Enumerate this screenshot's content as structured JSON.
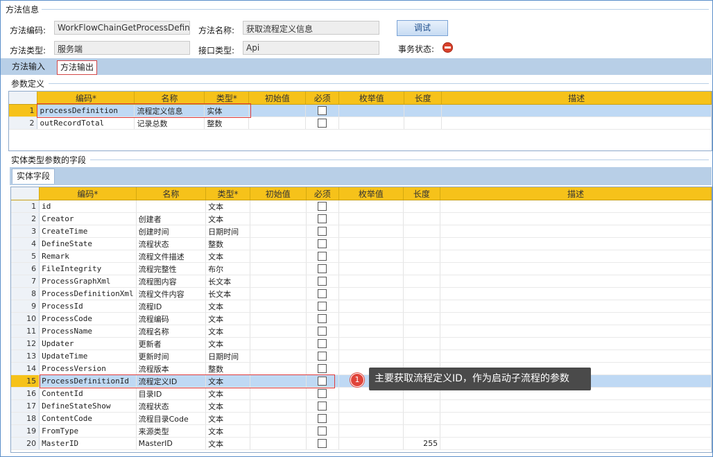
{
  "method_info": {
    "title": "方法信息",
    "code_label": "方法编码:",
    "code_value": "WorkFlowChainGetProcessDefinition",
    "name_label": "方法名称:",
    "name_value": "获取流程定义信息",
    "type_label": "方法类型:",
    "type_value": "服务端",
    "interface_label": "接口类型:",
    "interface_value": "Api",
    "debug_button": "调试",
    "tx_status_label": "事务状态:",
    "tx_status_icon": "no-entry-icon"
  },
  "tabs": [
    {
      "label": "方法输入",
      "active": false
    },
    {
      "label": "方法输出",
      "active": true
    }
  ],
  "param_section_title": "参数定义",
  "param_columns": [
    "编码*",
    "名称",
    "类型*",
    "初始值",
    "必须",
    "枚举值",
    "长度",
    "描述"
  ],
  "param_rows": [
    {
      "n": "1",
      "code": "processDefinition",
      "name": "流程定义信息",
      "type": "实体",
      "init": "",
      "enum": "",
      "len": "",
      "desc": ""
    },
    {
      "n": "2",
      "code": "outRecordTotal",
      "name": "记录总数",
      "type": "整数",
      "init": "",
      "enum": "",
      "len": "",
      "desc": ""
    }
  ],
  "entity_section_title": "实体类型参数的字段",
  "entity_tab": "实体字段",
  "entity_columns": [
    "编码*",
    "名称",
    "类型*",
    "初始值",
    "必须",
    "枚举值",
    "长度",
    "描述"
  ],
  "entity_rows": [
    {
      "n": "1",
      "code": "id",
      "name": "",
      "type": "文本",
      "len": ""
    },
    {
      "n": "2",
      "code": "Creator",
      "name": "创建者",
      "type": "文本",
      "len": ""
    },
    {
      "n": "3",
      "code": "CreateTime",
      "name": "创建时间",
      "type": "日期时间",
      "len": ""
    },
    {
      "n": "4",
      "code": "DefineState",
      "name": "流程状态",
      "type": "整数",
      "len": ""
    },
    {
      "n": "5",
      "code": "Remark",
      "name": "流程文件描述",
      "type": "文本",
      "len": ""
    },
    {
      "n": "6",
      "code": "FileIntegrity",
      "name": "流程完整性",
      "type": "布尔",
      "len": ""
    },
    {
      "n": "7",
      "code": "ProcessGraphXml",
      "name": "流程图内容",
      "type": "长文本",
      "len": ""
    },
    {
      "n": "8",
      "code": "ProcessDefinitionXml",
      "name": "流程文件内容",
      "type": "长文本",
      "len": ""
    },
    {
      "n": "9",
      "code": "ProcessId",
      "name": "流程ID",
      "type": "文本",
      "len": ""
    },
    {
      "n": "10",
      "code": "ProcessCode",
      "name": "流程编码",
      "type": "文本",
      "len": ""
    },
    {
      "n": "11",
      "code": "ProcessName",
      "name": "流程名称",
      "type": "文本",
      "len": ""
    },
    {
      "n": "12",
      "code": "Updater",
      "name": "更新者",
      "type": "文本",
      "len": ""
    },
    {
      "n": "13",
      "code": "UpdateTime",
      "name": "更新时间",
      "type": "日期时间",
      "len": ""
    },
    {
      "n": "14",
      "code": "ProcessVersion",
      "name": "流程版本",
      "type": "整数",
      "len": ""
    },
    {
      "n": "15",
      "code": "ProcessDefinitionId",
      "name": "流程定义ID",
      "type": "文本",
      "len": ""
    },
    {
      "n": "16",
      "code": "ContentId",
      "name": "目录ID",
      "type": "文本",
      "len": ""
    },
    {
      "n": "17",
      "code": "DefineStateShow",
      "name": "流程状态",
      "type": "文本",
      "len": ""
    },
    {
      "n": "18",
      "code": "ContentCode",
      "name": "流程目录Code",
      "type": "文本",
      "len": ""
    },
    {
      "n": "19",
      "code": "FromType",
      "name": "来源类型",
      "type": "文本",
      "len": ""
    },
    {
      "n": "20",
      "code": "MasterID",
      "name": "MasterID",
      "type": "文本",
      "len": "255"
    }
  ],
  "selected_entity_row": 15,
  "callout": {
    "badge": "1",
    "text": "主要获取流程定义ID，作为启动子流程的参数"
  }
}
